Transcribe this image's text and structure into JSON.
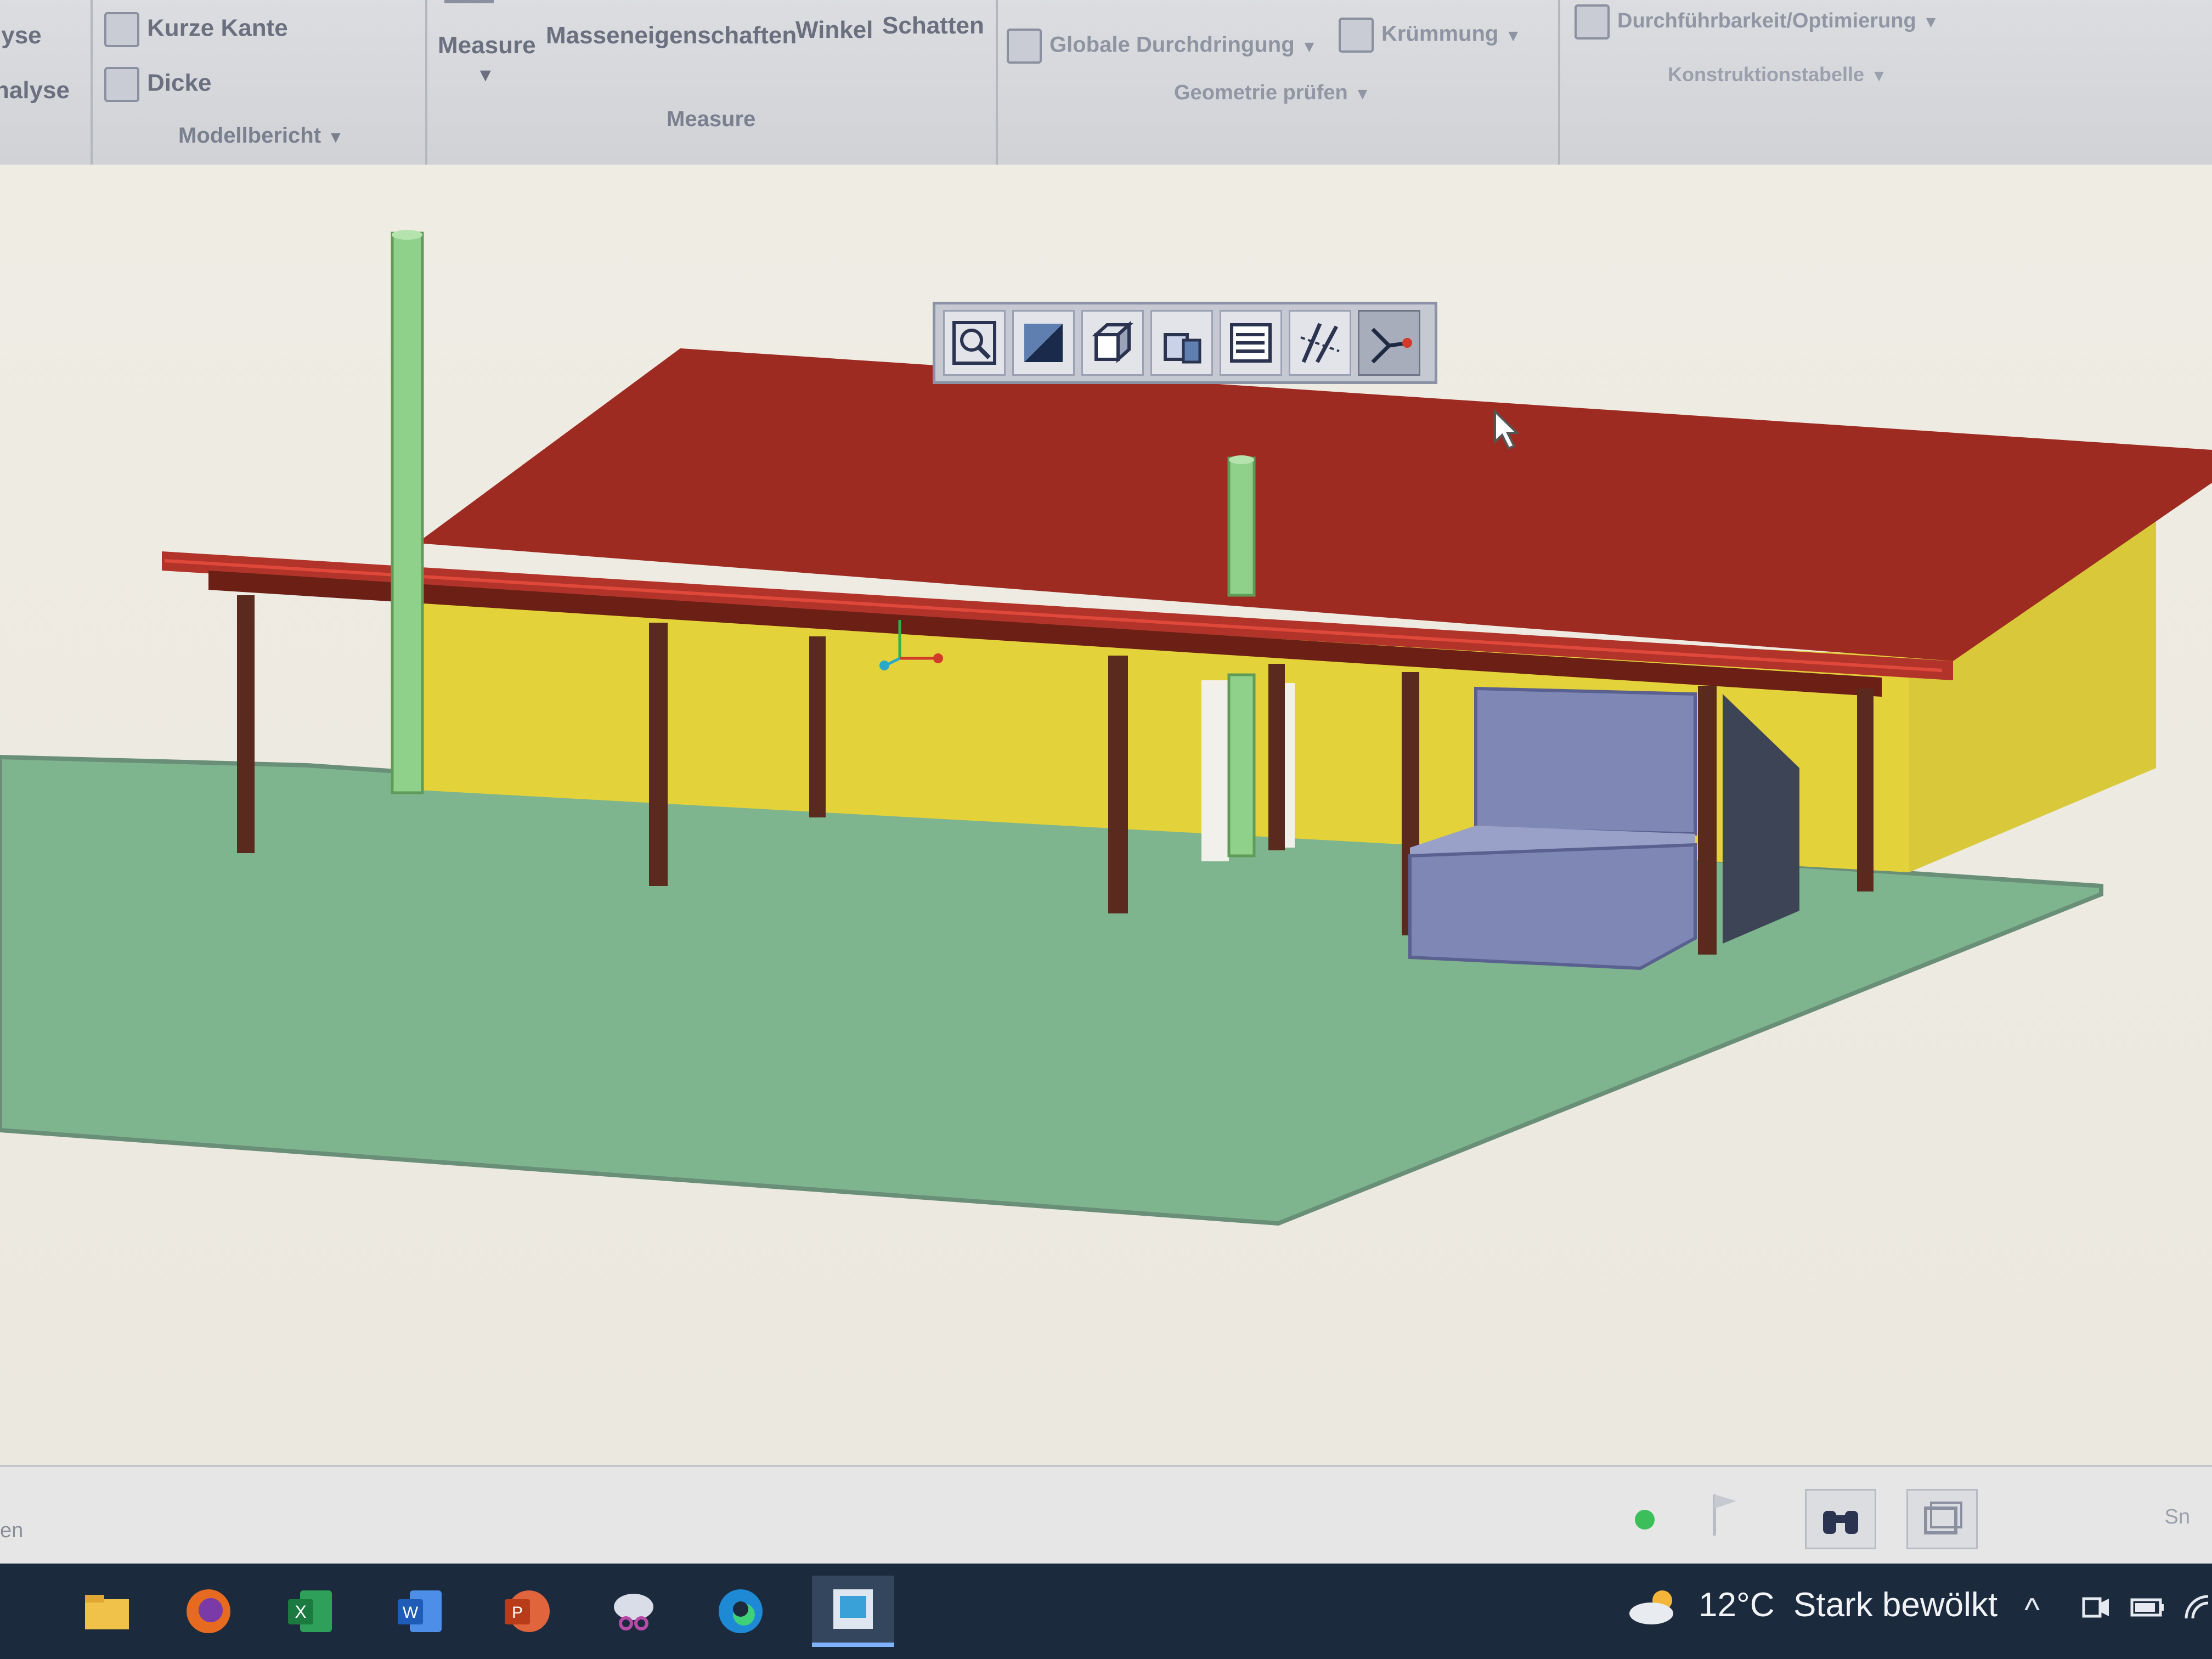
{
  "ribbon": {
    "left_items": [
      "lyse",
      "nalyse"
    ],
    "model_report": {
      "items": [
        {
          "label": "Kurze Kante",
          "icon": "short-edge-icon"
        },
        {
          "label": "Dicke",
          "icon": "thickness-icon"
        }
      ],
      "group_label": "Modellbericht"
    },
    "measure": {
      "items": [
        "Measure",
        "Masseneigenschaften",
        "Winkel",
        "Schatten"
      ],
      "group_label": "Measure"
    },
    "geometry_check": {
      "items": [
        {
          "label": "Globale Durchdringung",
          "icon": "interference-icon"
        },
        {
          "label": "Krümmung",
          "icon": "curvature-icon"
        }
      ],
      "group_label": "Geometrie prüfen"
    },
    "construction": {
      "items": [
        {
          "label": "Durchführbarkeit/Optimierung",
          "icon": "feasibility-icon"
        }
      ],
      "group_label": "Konstruktionstabelle"
    }
  },
  "viewport_toolbar": {
    "buttons": [
      {
        "icon": "zoom-fit-icon"
      },
      {
        "icon": "shading-icon"
      },
      {
        "icon": "box-view-icon"
      },
      {
        "icon": "section-view-icon"
      },
      {
        "icon": "properties-list-icon"
      },
      {
        "icon": "measure-pattern-icon"
      },
      {
        "icon": "connect-points-icon",
        "active": true
      }
    ]
  },
  "model_colors": {
    "roof": "#9e2b21",
    "walls": "#e3d23a",
    "ground": "#7fb58e",
    "posts": "#5a2a1e",
    "pipes": "#8fd08a",
    "seat": "#7f87b5"
  },
  "status_bar": {
    "left_text": "en",
    "right_text": "Sn"
  },
  "taskbar": {
    "apps": [
      {
        "icon": "file-explorer-icon"
      },
      {
        "icon": "firefox-icon"
      },
      {
        "icon": "excel-icon"
      },
      {
        "icon": "word-icon"
      },
      {
        "icon": "powerpoint-icon"
      },
      {
        "icon": "snipping-tool-icon"
      },
      {
        "icon": "edge-icon"
      },
      {
        "icon": "cad-app-icon",
        "active": true
      }
    ],
    "weather": {
      "temp": "12°C",
      "condition": "Stark bewölkt"
    }
  }
}
